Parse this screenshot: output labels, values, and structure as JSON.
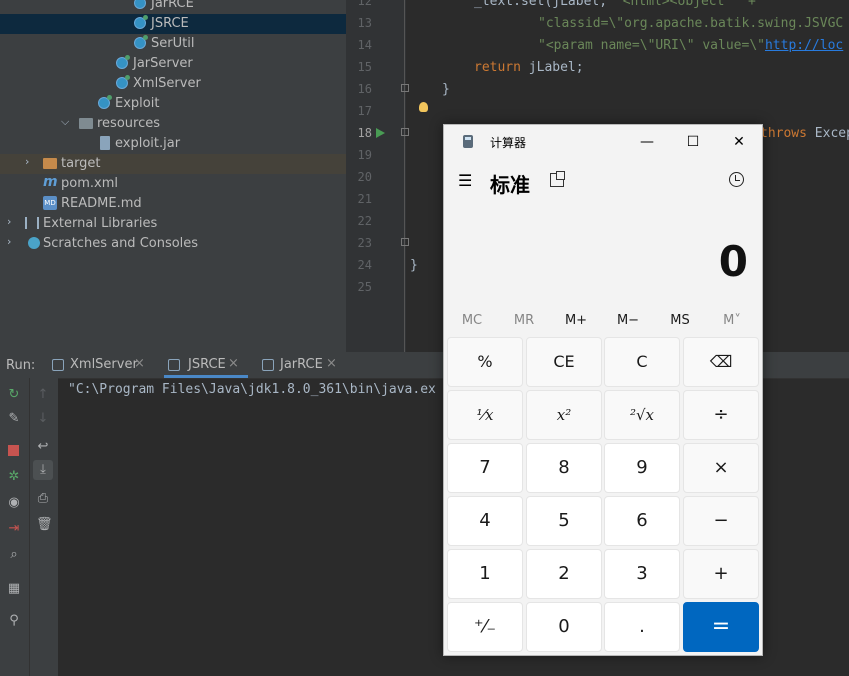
{
  "project_tree": {
    "items": [
      {
        "label": "JarRCE",
        "kind": "class"
      },
      {
        "label": "JSRCE",
        "kind": "class",
        "selected": true
      },
      {
        "label": "SerUtil",
        "kind": "class"
      },
      {
        "label": "JarServer",
        "kind": "class"
      },
      {
        "label": "XmlServer",
        "kind": "class"
      },
      {
        "label": "Exploit",
        "kind": "class"
      },
      {
        "label": "resources",
        "kind": "folder"
      },
      {
        "label": "exploit.jar",
        "kind": "jar"
      },
      {
        "label": "target",
        "kind": "folder"
      },
      {
        "label": "pom.xml",
        "kind": "maven"
      },
      {
        "label": "README.md",
        "kind": "markdown"
      },
      {
        "label": "External Libraries",
        "kind": "libraries"
      },
      {
        "label": "Scratches and Consoles",
        "kind": "scratches"
      }
    ]
  },
  "editor": {
    "line_numbers": [
      "12",
      "13",
      "14",
      "15",
      "16",
      "17",
      "18",
      "19",
      "20",
      "21",
      "22",
      "23",
      "24",
      "25"
    ],
    "line12": {
      "a": "_text.set(jLabel, ",
      "b": "\"<html><object \" +"
    },
    "line13": "\"classid=\\\"org.apache.batik.swing.JSVGC",
    "line14": {
      "a": "\"<param name=\\\"URI\\\" value=\\\"",
      "link": "http://loc"
    },
    "line15": {
      "kw": "return",
      "rest": " jLabel;"
    },
    "line16": "}",
    "line18": {
      "kw": "throws",
      "rest": " Excep"
    },
    "line24": "}"
  },
  "run_panel": {
    "label": "Run:",
    "tabs": [
      {
        "label": "XmlServer",
        "active": false
      },
      {
        "label": "JSRCE",
        "active": true
      },
      {
        "label": "JarRCE",
        "active": false
      }
    ],
    "close_glyph": "×",
    "console_text": "\"C:\\Program Files\\Java\\jdk1.8.0_361\\bin\\java.ex"
  },
  "calculator": {
    "title": "计算器",
    "mode": "标准",
    "display": "0",
    "window_buttons": {
      "minimize": "—",
      "maximize": "☐",
      "close": "✕"
    },
    "hamburger": "☰",
    "memory": [
      "MC",
      "MR",
      "M+",
      "M−",
      "MS",
      "M˅"
    ],
    "keys": [
      "%",
      "CE",
      "C",
      "⌫",
      "¹⁄x",
      "x²",
      "²√x",
      "÷",
      "7",
      "8",
      "9",
      "×",
      "4",
      "5",
      "6",
      "−",
      "1",
      "2",
      "3",
      "+",
      "⁺⁄₋",
      "0",
      ".",
      "="
    ],
    "accent_color": "#0067c0"
  }
}
